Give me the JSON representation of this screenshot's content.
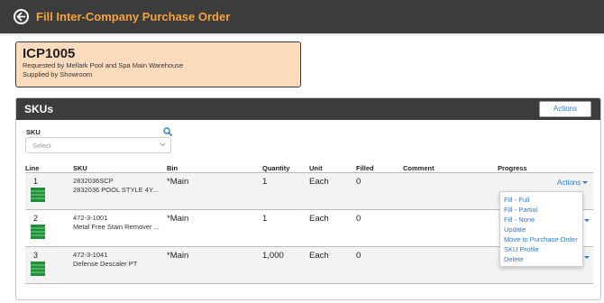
{
  "header": {
    "title": "Fill Inter-Company Purchase Order"
  },
  "order": {
    "id": "ICP1005",
    "requested_by": "Requested by Mellark Pool and Spa Main Warehouse",
    "supplied_by": "Supplied by Showroom"
  },
  "skus_panel": {
    "title": "SKUs",
    "actions_label": "Actions",
    "filter": {
      "label": "SKU",
      "placeholder": "Select"
    },
    "columns": [
      "Line",
      "SKU",
      "Bin",
      "Quantity",
      "Unit",
      "Filled",
      "Comment",
      "Progress"
    ],
    "rows": [
      {
        "line": "1",
        "sku": "2832036SCP",
        "description": "2832036 POOL STYLE 4Y...",
        "bin": "*Main",
        "quantity": "1",
        "unit": "Each",
        "filled": "0",
        "comment": "",
        "actions_label": "Actions"
      },
      {
        "line": "2",
        "sku": "472-3-1001",
        "description": "Metal Free Stain Remover ...",
        "bin": "*Main",
        "quantity": "1",
        "unit": "Each",
        "filled": "0",
        "comment": "",
        "actions_label": ""
      },
      {
        "line": "3",
        "sku": "472-3-1041",
        "description": "Defense Descaler PT",
        "bin": "*Main",
        "quantity": "1,000",
        "unit": "Each",
        "filled": "0",
        "comment": "",
        "actions_label": ""
      }
    ]
  },
  "actions_menu": {
    "items": [
      "Fill - Full",
      "Fill - Partial",
      "Fill - None",
      "Update",
      "Move to Purchase Order",
      "SKU Profile",
      "Delete"
    ]
  },
  "colors": {
    "topbar": "#3c3c3c",
    "title_accent": "#f7a23b",
    "order_card_bg": "#fddcbd",
    "link_blue": "#2b7cd3",
    "pallet_green": "#1f8f3a"
  },
  "icons": {
    "back": "back-arrow-circle-icon",
    "search": "search-icon",
    "select_chevron": "chevron-down-icon",
    "row_status": "pallet-icon"
  }
}
